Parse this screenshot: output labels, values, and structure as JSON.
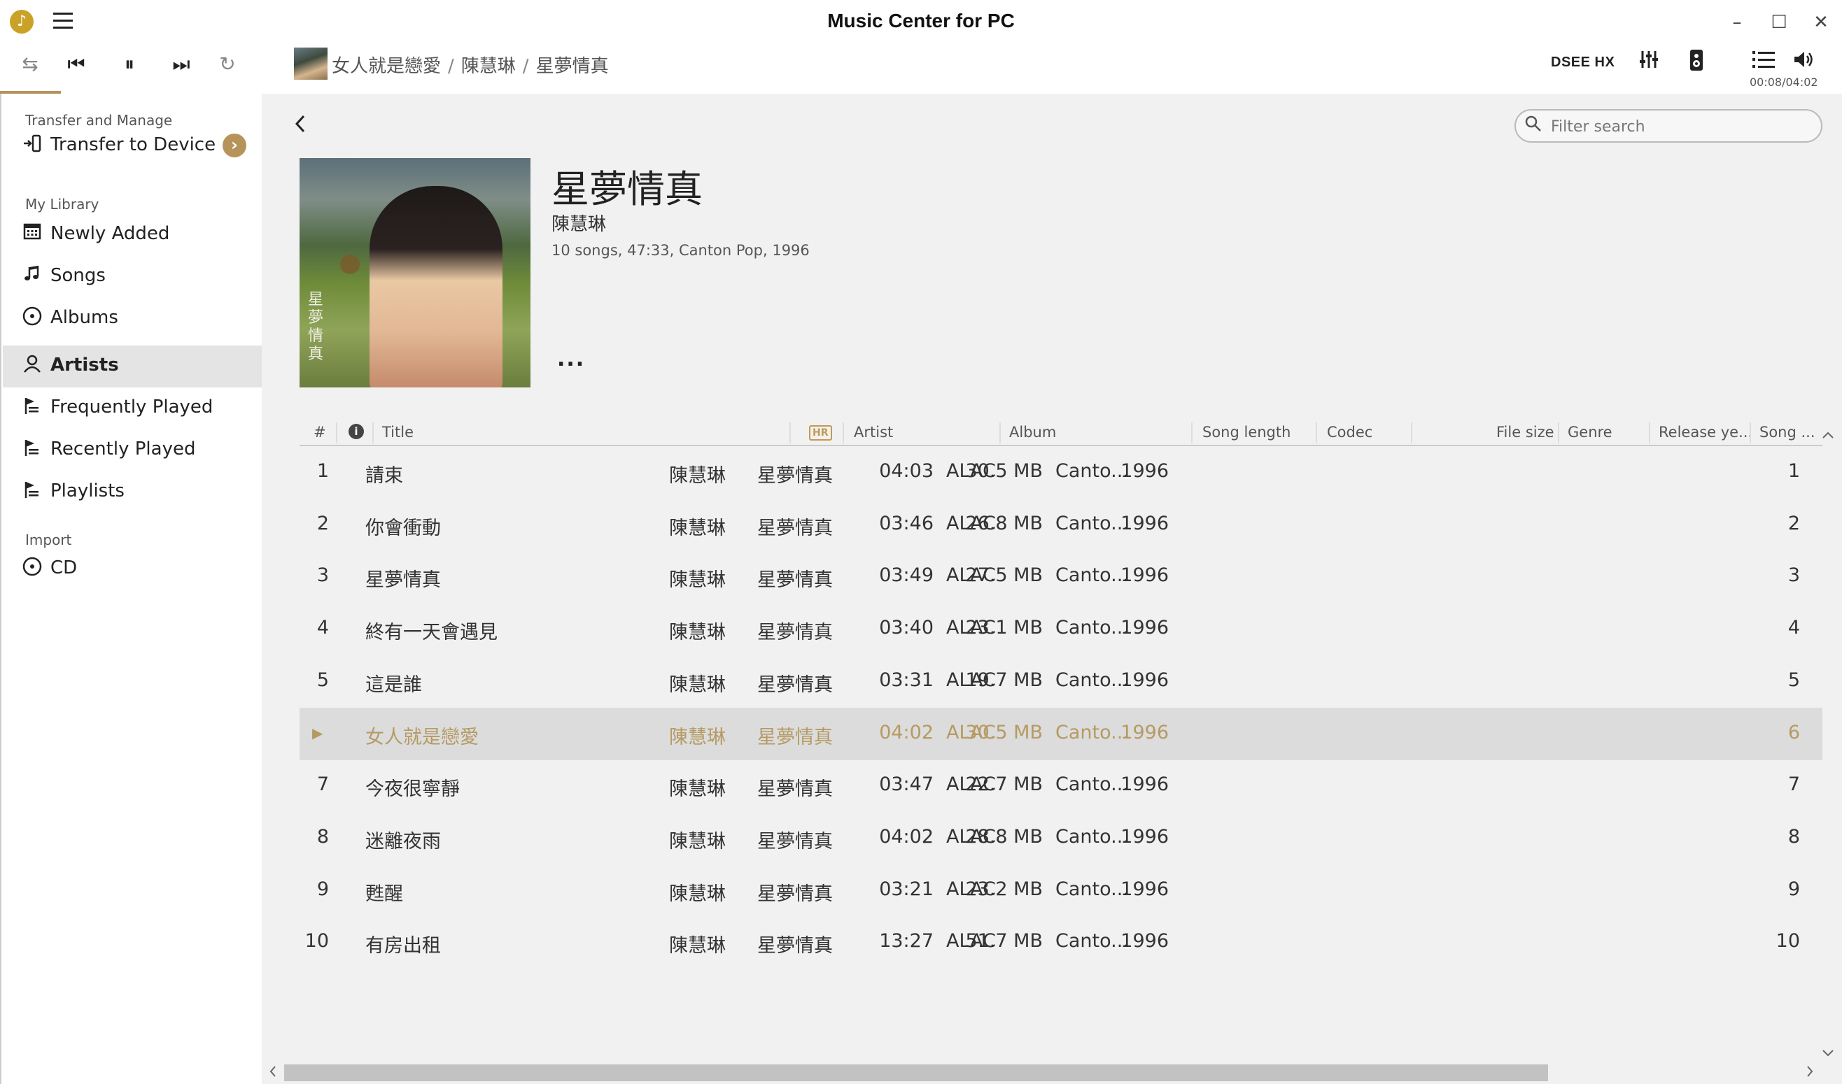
{
  "window": {
    "title": "Music Center for PC",
    "logo_glyph": "♪",
    "controls": {
      "minimize": "–",
      "maximize": "☐",
      "close": "✕"
    }
  },
  "player": {
    "repeat_all_glyph": "⇆",
    "prev_glyph": "⏮",
    "pause_glyph": "⏸",
    "next_glyph": "⏭",
    "repeat_glyph": "↻",
    "now_playing": {
      "song": "女人就是戀愛",
      "artist": "陳慧琳",
      "album": "星夢情真",
      "separator": "/"
    },
    "dsee_label": "DSEE HX",
    "time": "00:08/04:02",
    "progress_fraction": 0.033
  },
  "sidebar": {
    "transfer_section": "Transfer and Manage",
    "transfer_item": "Transfer to Device",
    "library_section": "My Library",
    "library_items": [
      {
        "label": "Newly Added",
        "icon": "calendar-icon"
      },
      {
        "label": "Songs",
        "icon": "music-note-icon"
      },
      {
        "label": "Albums",
        "icon": "disc-icon"
      },
      {
        "label": "Artists",
        "icon": "person-icon",
        "active": true
      },
      {
        "label": "Frequently Played",
        "icon": "playlist-flag-icon"
      },
      {
        "label": "Recently Played",
        "icon": "playlist-flag-icon"
      },
      {
        "label": "Playlists",
        "icon": "playlist-flag-icon"
      }
    ],
    "import_section": "Import",
    "import_item": "CD"
  },
  "search": {
    "placeholder": "Filter search",
    "value": ""
  },
  "album": {
    "title": "星夢情真",
    "artist": "陳慧琳",
    "meta": "10 songs, 47:33, Canton Pop, 1996",
    "cover_text": "星夢情真",
    "more_glyph": "..."
  },
  "table": {
    "headers": {
      "num": "#",
      "info": "i",
      "title": "Title",
      "hr": "HR",
      "artist": "Artist",
      "album": "Album",
      "length": "Song length",
      "codec": "Codec",
      "size": "File size",
      "genre": "Genre",
      "year": "Release ye...",
      "song_no": "Song ..."
    },
    "playing_glyph": "▶",
    "rows": [
      {
        "num": "1",
        "title": "請束",
        "artist": "陳慧琳",
        "album": "星夢情真",
        "length": "04:03",
        "codec": "ALAC",
        "size": "30.5 MB",
        "genre": "Canto...",
        "year": "1996",
        "song_no": "1"
      },
      {
        "num": "2",
        "title": "你會衝動",
        "artist": "陳慧琳",
        "album": "星夢情真",
        "length": "03:46",
        "codec": "ALAC",
        "size": "26.8 MB",
        "genre": "Canto...",
        "year": "1996",
        "song_no": "2"
      },
      {
        "num": "3",
        "title": "星夢情真",
        "artist": "陳慧琳",
        "album": "星夢情真",
        "length": "03:49",
        "codec": "ALAC",
        "size": "27.5 MB",
        "genre": "Canto...",
        "year": "1996",
        "song_no": "3"
      },
      {
        "num": "4",
        "title": "終有一天會遇見",
        "artist": "陳慧琳",
        "album": "星夢情真",
        "length": "03:40",
        "codec": "ALAC",
        "size": "23.1 MB",
        "genre": "Canto...",
        "year": "1996",
        "song_no": "4"
      },
      {
        "num": "5",
        "title": "這是誰",
        "artist": "陳慧琳",
        "album": "星夢情真",
        "length": "03:31",
        "codec": "ALAC",
        "size": "19.7 MB",
        "genre": "Canto...",
        "year": "1996",
        "song_no": "5"
      },
      {
        "num": "",
        "title": "女人就是戀愛",
        "artist": "陳慧琳",
        "album": "星夢情真",
        "length": "04:02",
        "codec": "ALAC",
        "size": "30.5 MB",
        "genre": "Canto...",
        "year": "1996",
        "song_no": "6",
        "current": true
      },
      {
        "num": "7",
        "title": "今夜很寧靜",
        "artist": "陳慧琳",
        "album": "星夢情真",
        "length": "03:47",
        "codec": "ALAC",
        "size": "22.7 MB",
        "genre": "Canto...",
        "year": "1996",
        "song_no": "7"
      },
      {
        "num": "8",
        "title": "迷離夜雨",
        "artist": "陳慧琳",
        "album": "星夢情真",
        "length": "04:02",
        "codec": "ALAC",
        "size": "28.8 MB",
        "genre": "Canto...",
        "year": "1996",
        "song_no": "8"
      },
      {
        "num": "9",
        "title": "甦醒",
        "artist": "陳慧琳",
        "album": "星夢情真",
        "length": "03:21",
        "codec": "ALAC",
        "size": "23.2 MB",
        "genre": "Canto...",
        "year": "1996",
        "song_no": "9"
      },
      {
        "num": "10",
        "title": "有房出租",
        "artist": "陳慧琳",
        "album": "星夢情真",
        "length": "13:27",
        "codec": "ALAC",
        "size": "51.7 MB",
        "genre": "Canto...",
        "year": "1996",
        "song_no": "10"
      }
    ]
  },
  "colors": {
    "accent": "#b5935a",
    "current_row_text": "#b59a63",
    "main_bg": "#f1f1f1"
  }
}
